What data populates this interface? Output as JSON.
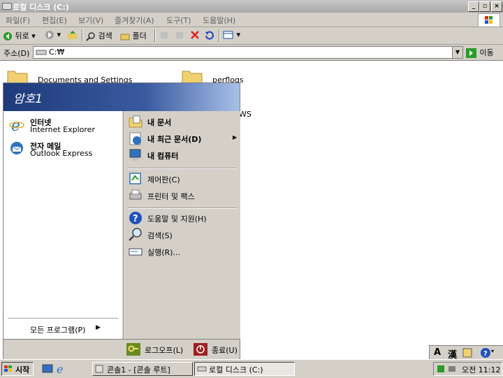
{
  "window": {
    "title": "로컬 디스크 (C:)",
    "menu": [
      "파일(F)",
      "편집(E)",
      "보기(V)",
      "즐겨찾기(A)",
      "도구(T)",
      "도움말(H)"
    ],
    "toolbar": {
      "back": "뒤로",
      "search": "검색",
      "folders": "폴더"
    },
    "address": {
      "label": "주소(D)",
      "value": "C:₩",
      "go": "이동"
    }
  },
  "content": {
    "items": [
      "Documents and Settings",
      "perflogs",
      "WS"
    ]
  },
  "start_menu": {
    "user": "암호1",
    "pinned": [
      {
        "title": "인터넷",
        "subtitle": "Internet Explorer",
        "icon": "ie-icon"
      },
      {
        "title": "전자 메일",
        "subtitle": "Outlook Express",
        "icon": "outlook-express-icon"
      }
    ],
    "all_programs": "모든 프로그램(P)",
    "right_group1": [
      "내 문서",
      "내 최근 문서(D)",
      "내 컴퓨터"
    ],
    "right_group2": [
      "제어판(C)",
      "프린터 및 팩스"
    ],
    "right_group3": [
      "도움말 및 지원(H)",
      "검색(S)",
      "실행(R)..."
    ],
    "logoff": "로그오프(L)",
    "shutdown": "종료(U)"
  },
  "taskbar": {
    "start": "시작",
    "tasks": [
      "콘솔1 - [콘솔 루트]",
      "로컬 디스크 (C:)"
    ],
    "clock": "오전 11:12"
  },
  "langbar": {
    "a": "A",
    "han": "漢"
  },
  "colors": {
    "title_blue": "#1e3a7a",
    "face": "#d4d0c8"
  }
}
